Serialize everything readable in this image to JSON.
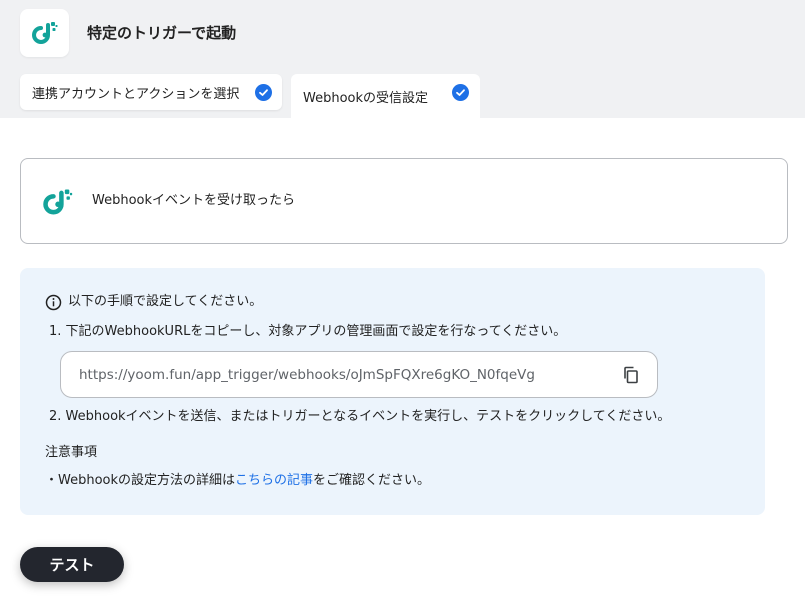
{
  "header": {
    "title": "特定のトリガーで起動",
    "logo_icon": "yoom-logo-icon"
  },
  "tabs": [
    {
      "label": "連携アカウントとアクションを選択",
      "completed": true
    },
    {
      "label": "Webhookの受信設定",
      "completed": true,
      "active": true
    }
  ],
  "trigger": {
    "label": "Webhookイベントを受け取ったら"
  },
  "instructions": {
    "heading": "以下の手順で設定してください。",
    "step1": "1. 下記のWebhookURLをコピーし、対象アプリの管理画面で設定を行なってください。",
    "webhook_url": "https://yoom.fun/app_trigger/webhooks/oJmSpFQXre6gKO_N0fqeVg",
    "step2": "2. Webhookイベントを送信、またはトリガーとなるイベントを実行し、テストをクリックしてください。",
    "notes_title": "注意事項",
    "note_prefix": "・Webhookの設定方法の詳細は",
    "note_link": "こちらの記事",
    "note_suffix": "をご確認ください。"
  },
  "actions": {
    "test_label": "テスト"
  },
  "colors": {
    "accent": "#1e70e6",
    "logo_teal": "#13a39a",
    "info_bg": "#ecf4fc",
    "button_dark": "#23262e"
  }
}
